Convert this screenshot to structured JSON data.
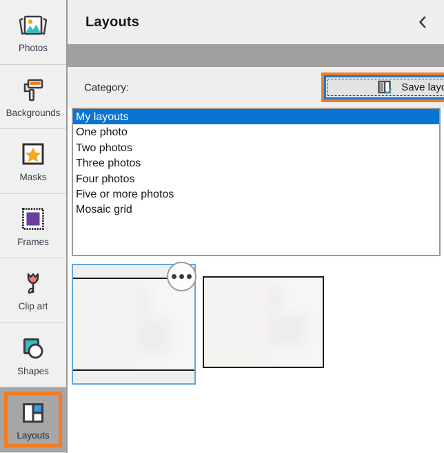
{
  "sidebar": {
    "items": [
      {
        "label": "Photos",
        "icon": "photos-icon",
        "selected": false
      },
      {
        "label": "Backgrounds",
        "icon": "paint-roller-icon",
        "selected": false
      },
      {
        "label": "Masks",
        "icon": "star-mask-icon",
        "selected": false
      },
      {
        "label": "Frames",
        "icon": "frame-icon",
        "selected": false
      },
      {
        "label": "Clip art",
        "icon": "tulip-icon",
        "selected": false
      },
      {
        "label": "Shapes",
        "icon": "shapes-icon",
        "selected": false
      },
      {
        "label": "Layouts",
        "icon": "layouts-icon",
        "selected": true
      }
    ]
  },
  "header": {
    "title": "Layouts",
    "collapse_icon": "chevron-left-icon"
  },
  "category": {
    "label": "Category:"
  },
  "save_button": {
    "label": "Save layout",
    "icon": "save-layout-icon",
    "highlight_color": "#f47b20",
    "focus_color": "#1878d0"
  },
  "layout_list": {
    "items": [
      {
        "label": "My layouts",
        "selected": true
      },
      {
        "label": "One photo",
        "selected": false
      },
      {
        "label": "Two photos",
        "selected": false
      },
      {
        "label": "Three photos",
        "selected": false
      },
      {
        "label": "Four photos",
        "selected": false
      },
      {
        "label": "Five or more photos",
        "selected": false
      },
      {
        "label": "Mosaic grid",
        "selected": false
      }
    ],
    "selection_color": "#0a74d4"
  },
  "thumbnails": [
    {
      "name": "layout-thumbnail-1",
      "selected": true,
      "has_more_menu": true,
      "more_icon": "ellipsis-icon"
    },
    {
      "name": "layout-thumbnail-2",
      "selected": false,
      "has_more_menu": false,
      "more_icon": ""
    }
  ],
  "colors": {
    "accent_orange": "#f47b20",
    "accent_blue": "#1878d0",
    "panel_gray": "#a0a0a0",
    "chrome_gray": "#efefef"
  }
}
